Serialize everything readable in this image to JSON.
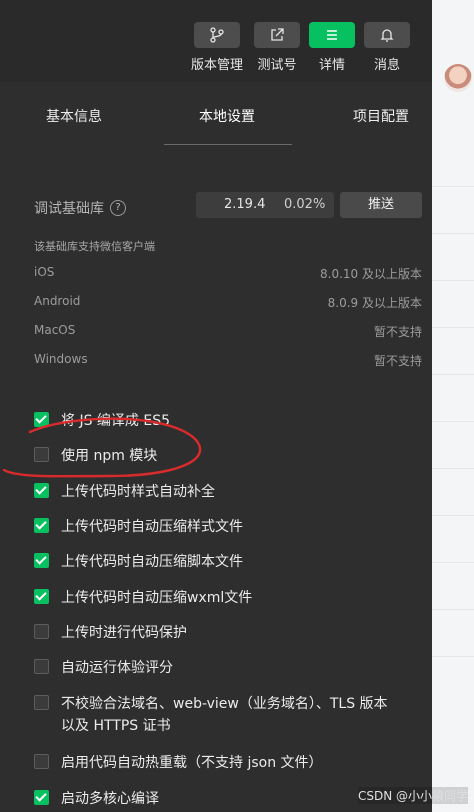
{
  "toolbar": {
    "buttons": [
      {
        "label": "版本管理",
        "icon": "branch-icon"
      },
      {
        "label": "测试号",
        "icon": "external-link-icon"
      },
      {
        "label": "详情",
        "icon": "menu-icon",
        "active": true
      },
      {
        "label": "消息",
        "icon": "bell-icon"
      }
    ]
  },
  "tabs": [
    {
      "label": "基本信息"
    },
    {
      "label": "本地设置",
      "active": true
    },
    {
      "label": "项目配置"
    }
  ],
  "base_library": {
    "label": "调试基础库",
    "version": "2.19.4",
    "percent": "0.02%",
    "push_label": "推送",
    "note": "该基础库支持微信客户端",
    "support": [
      {
        "platform": "iOS",
        "value": "8.0.10 及以上版本"
      },
      {
        "platform": "Android",
        "value": "8.0.9 及以上版本"
      },
      {
        "platform": "MacOS",
        "value": "暂不支持"
      },
      {
        "platform": "Windows",
        "value": "暂不支持"
      }
    ]
  },
  "options": [
    {
      "label": "将 JS 编译成 ES5",
      "checked": true
    },
    {
      "label": "使用 npm 模块",
      "checked": false
    },
    {
      "label": "上传代码时样式自动补全",
      "checked": true
    },
    {
      "label": "上传代码时自动压缩样式文件",
      "checked": true
    },
    {
      "label": "上传代码时自动压缩脚本文件",
      "checked": true
    },
    {
      "label": "上传代码时自动压缩wxml文件",
      "checked": true
    },
    {
      "label": "上传时进行代码保护",
      "checked": false
    },
    {
      "label": "自动运行体验评分",
      "checked": false
    },
    {
      "label": "不校验合法域名、web-view（业务域名）、TLS 版本以及 HTTPS 证书",
      "checked": false
    },
    {
      "label": "启用代码自动热重载（不支持 json 文件）",
      "checked": false
    },
    {
      "label": "启动多核心编译",
      "checked": true
    }
  ],
  "watermark": "CSDN @小小猿同学",
  "colors": {
    "accent": "#07c160",
    "annotation": "#d92b2b",
    "panel": "#2e2e2e"
  }
}
